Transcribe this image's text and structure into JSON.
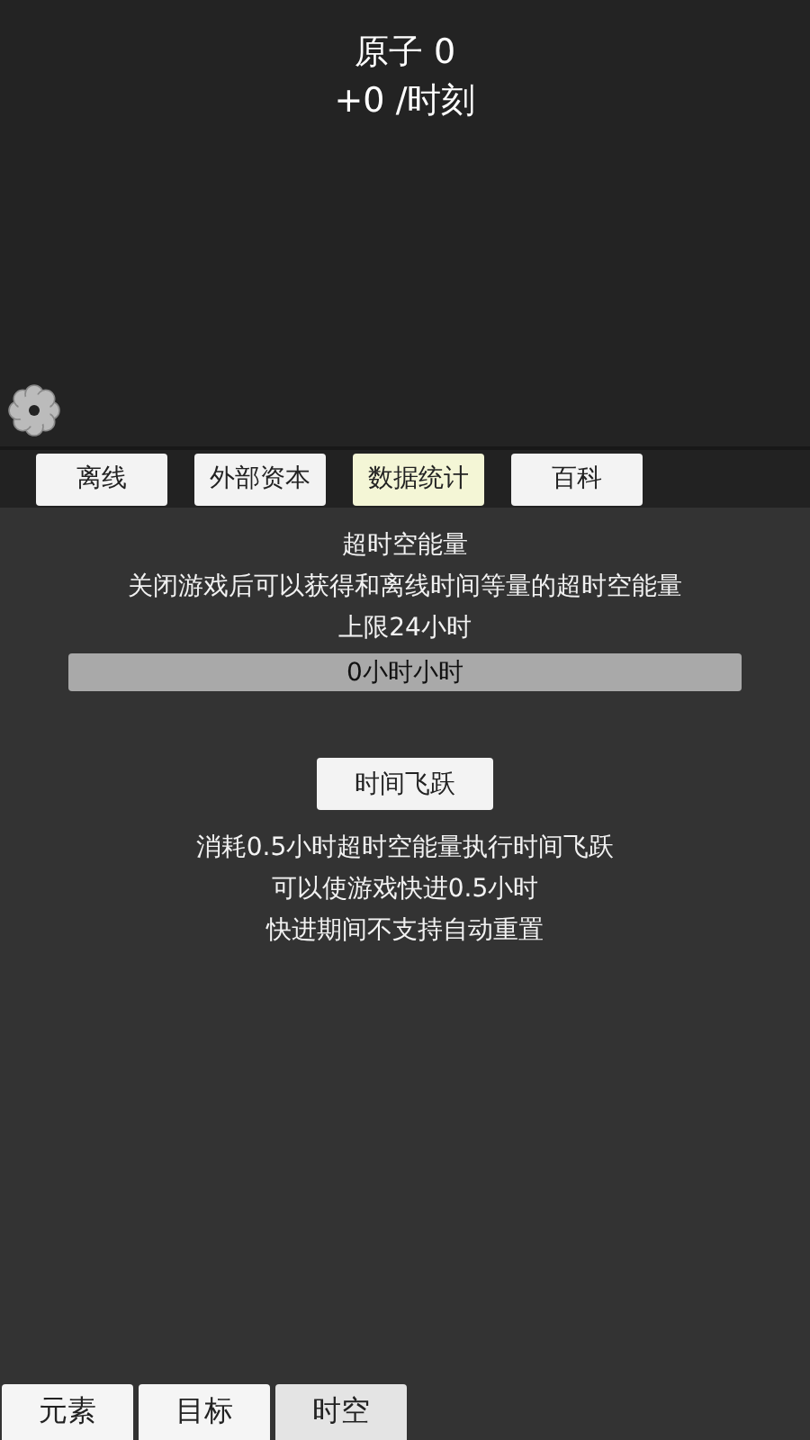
{
  "header": {
    "resource": "原子 0",
    "rate": "+0 /时刻"
  },
  "tabs": [
    {
      "label": "离线",
      "selected": false
    },
    {
      "label": "外部资本",
      "selected": false
    },
    {
      "label": "数据统计",
      "selected": true
    },
    {
      "label": "百科",
      "selected": false
    }
  ],
  "energy": {
    "title": "超时空能量",
    "description": "关闭游戏后可以获得和离线时间等量的超时空能量",
    "limit": "上限24小时",
    "reading": "0小时小时"
  },
  "time_jump": {
    "button": "时间飞跃",
    "notes": [
      "消耗0.5小时超时空能量执行时间飞跃",
      "可以使游戏快进0.5小时",
      "快进期间不支持自动重置"
    ]
  },
  "bottom_tabs": [
    {
      "label": "元素",
      "selected": false
    },
    {
      "label": "目标",
      "selected": false
    },
    {
      "label": "时空",
      "selected": true
    }
  ]
}
